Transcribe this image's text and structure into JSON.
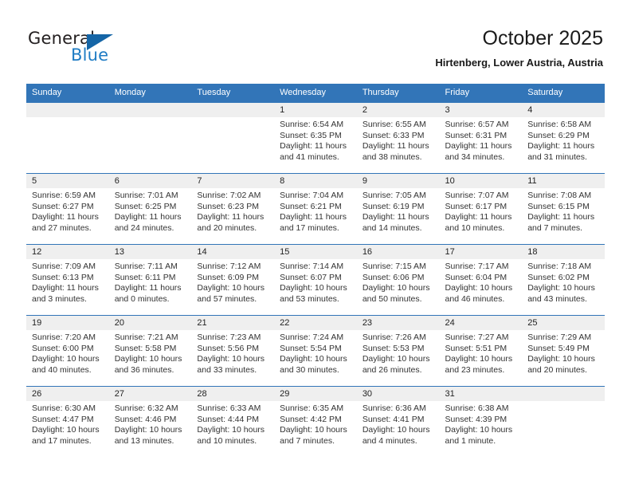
{
  "logo": {
    "word1": "General",
    "word2": "Blue",
    "triangle_color": "#1565a6",
    "blue_color": "#1f7cc4"
  },
  "header": {
    "title": "October 2025",
    "location": "Hirtenberg, Lower Austria, Austria"
  },
  "theme": {
    "header_blue": "#3275b8",
    "daynum_band": "#efefef"
  },
  "weekday_headers": [
    "Sunday",
    "Monday",
    "Tuesday",
    "Wednesday",
    "Thursday",
    "Friday",
    "Saturday"
  ],
  "labels": {
    "sunrise_prefix": "Sunrise:",
    "sunset_prefix": "Sunset:",
    "daylight_prefix": "Daylight:"
  },
  "weeks": [
    [
      {
        "day": "",
        "empty": true
      },
      {
        "day": "",
        "empty": true
      },
      {
        "day": "",
        "empty": true
      },
      {
        "day": "1",
        "sunrise": "Sunrise: 6:54 AM",
        "sunset": "Sunset: 6:35 PM",
        "daylight1": "Daylight: 11 hours",
        "daylight2": "and 41 minutes."
      },
      {
        "day": "2",
        "sunrise": "Sunrise: 6:55 AM",
        "sunset": "Sunset: 6:33 PM",
        "daylight1": "Daylight: 11 hours",
        "daylight2": "and 38 minutes."
      },
      {
        "day": "3",
        "sunrise": "Sunrise: 6:57 AM",
        "sunset": "Sunset: 6:31 PM",
        "daylight1": "Daylight: 11 hours",
        "daylight2": "and 34 minutes."
      },
      {
        "day": "4",
        "sunrise": "Sunrise: 6:58 AM",
        "sunset": "Sunset: 6:29 PM",
        "daylight1": "Daylight: 11 hours",
        "daylight2": "and 31 minutes."
      }
    ],
    [
      {
        "day": "5",
        "sunrise": "Sunrise: 6:59 AM",
        "sunset": "Sunset: 6:27 PM",
        "daylight1": "Daylight: 11 hours",
        "daylight2": "and 27 minutes."
      },
      {
        "day": "6",
        "sunrise": "Sunrise: 7:01 AM",
        "sunset": "Sunset: 6:25 PM",
        "daylight1": "Daylight: 11 hours",
        "daylight2": "and 24 minutes."
      },
      {
        "day": "7",
        "sunrise": "Sunrise: 7:02 AM",
        "sunset": "Sunset: 6:23 PM",
        "daylight1": "Daylight: 11 hours",
        "daylight2": "and 20 minutes."
      },
      {
        "day": "8",
        "sunrise": "Sunrise: 7:04 AM",
        "sunset": "Sunset: 6:21 PM",
        "daylight1": "Daylight: 11 hours",
        "daylight2": "and 17 minutes."
      },
      {
        "day": "9",
        "sunrise": "Sunrise: 7:05 AM",
        "sunset": "Sunset: 6:19 PM",
        "daylight1": "Daylight: 11 hours",
        "daylight2": "and 14 minutes."
      },
      {
        "day": "10",
        "sunrise": "Sunrise: 7:07 AM",
        "sunset": "Sunset: 6:17 PM",
        "daylight1": "Daylight: 11 hours",
        "daylight2": "and 10 minutes."
      },
      {
        "day": "11",
        "sunrise": "Sunrise: 7:08 AM",
        "sunset": "Sunset: 6:15 PM",
        "daylight1": "Daylight: 11 hours",
        "daylight2": "and 7 minutes."
      }
    ],
    [
      {
        "day": "12",
        "sunrise": "Sunrise: 7:09 AM",
        "sunset": "Sunset: 6:13 PM",
        "daylight1": "Daylight: 11 hours",
        "daylight2": "and 3 minutes."
      },
      {
        "day": "13",
        "sunrise": "Sunrise: 7:11 AM",
        "sunset": "Sunset: 6:11 PM",
        "daylight1": "Daylight: 11 hours",
        "daylight2": "and 0 minutes."
      },
      {
        "day": "14",
        "sunrise": "Sunrise: 7:12 AM",
        "sunset": "Sunset: 6:09 PM",
        "daylight1": "Daylight: 10 hours",
        "daylight2": "and 57 minutes."
      },
      {
        "day": "15",
        "sunrise": "Sunrise: 7:14 AM",
        "sunset": "Sunset: 6:07 PM",
        "daylight1": "Daylight: 10 hours",
        "daylight2": "and 53 minutes."
      },
      {
        "day": "16",
        "sunrise": "Sunrise: 7:15 AM",
        "sunset": "Sunset: 6:06 PM",
        "daylight1": "Daylight: 10 hours",
        "daylight2": "and 50 minutes."
      },
      {
        "day": "17",
        "sunrise": "Sunrise: 7:17 AM",
        "sunset": "Sunset: 6:04 PM",
        "daylight1": "Daylight: 10 hours",
        "daylight2": "and 46 minutes."
      },
      {
        "day": "18",
        "sunrise": "Sunrise: 7:18 AM",
        "sunset": "Sunset: 6:02 PM",
        "daylight1": "Daylight: 10 hours",
        "daylight2": "and 43 minutes."
      }
    ],
    [
      {
        "day": "19",
        "sunrise": "Sunrise: 7:20 AM",
        "sunset": "Sunset: 6:00 PM",
        "daylight1": "Daylight: 10 hours",
        "daylight2": "and 40 minutes."
      },
      {
        "day": "20",
        "sunrise": "Sunrise: 7:21 AM",
        "sunset": "Sunset: 5:58 PM",
        "daylight1": "Daylight: 10 hours",
        "daylight2": "and 36 minutes."
      },
      {
        "day": "21",
        "sunrise": "Sunrise: 7:23 AM",
        "sunset": "Sunset: 5:56 PM",
        "daylight1": "Daylight: 10 hours",
        "daylight2": "and 33 minutes."
      },
      {
        "day": "22",
        "sunrise": "Sunrise: 7:24 AM",
        "sunset": "Sunset: 5:54 PM",
        "daylight1": "Daylight: 10 hours",
        "daylight2": "and 30 minutes."
      },
      {
        "day": "23",
        "sunrise": "Sunrise: 7:26 AM",
        "sunset": "Sunset: 5:53 PM",
        "daylight1": "Daylight: 10 hours",
        "daylight2": "and 26 minutes."
      },
      {
        "day": "24",
        "sunrise": "Sunrise: 7:27 AM",
        "sunset": "Sunset: 5:51 PM",
        "daylight1": "Daylight: 10 hours",
        "daylight2": "and 23 minutes."
      },
      {
        "day": "25",
        "sunrise": "Sunrise: 7:29 AM",
        "sunset": "Sunset: 5:49 PM",
        "daylight1": "Daylight: 10 hours",
        "daylight2": "and 20 minutes."
      }
    ],
    [
      {
        "day": "26",
        "sunrise": "Sunrise: 6:30 AM",
        "sunset": "Sunset: 4:47 PM",
        "daylight1": "Daylight: 10 hours",
        "daylight2": "and 17 minutes."
      },
      {
        "day": "27",
        "sunrise": "Sunrise: 6:32 AM",
        "sunset": "Sunset: 4:46 PM",
        "daylight1": "Daylight: 10 hours",
        "daylight2": "and 13 minutes."
      },
      {
        "day": "28",
        "sunrise": "Sunrise: 6:33 AM",
        "sunset": "Sunset: 4:44 PM",
        "daylight1": "Daylight: 10 hours",
        "daylight2": "and 10 minutes."
      },
      {
        "day": "29",
        "sunrise": "Sunrise: 6:35 AM",
        "sunset": "Sunset: 4:42 PM",
        "daylight1": "Daylight: 10 hours",
        "daylight2": "and 7 minutes."
      },
      {
        "day": "30",
        "sunrise": "Sunrise: 6:36 AM",
        "sunset": "Sunset: 4:41 PM",
        "daylight1": "Daylight: 10 hours",
        "daylight2": "and 4 minutes."
      },
      {
        "day": "31",
        "sunrise": "Sunrise: 6:38 AM",
        "sunset": "Sunset: 4:39 PM",
        "daylight1": "Daylight: 10 hours",
        "daylight2": "and 1 minute."
      },
      {
        "day": "",
        "empty": true
      }
    ]
  ]
}
